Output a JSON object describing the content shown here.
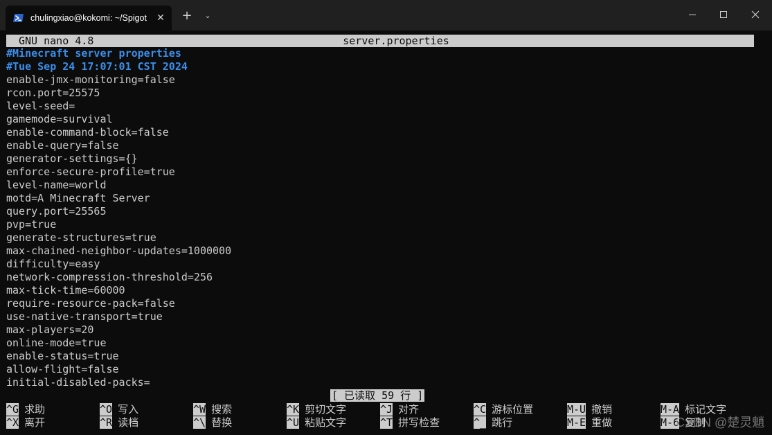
{
  "window": {
    "tab_title": "chulingxiao@kokomi: ~/Spigot",
    "tab_icon": "powershell-terminal-icon",
    "close_glyph": "✕",
    "new_tab_glyph": "+",
    "dropdown_glyph": "⌄"
  },
  "nano": {
    "version": "GNU nano 4.8",
    "filename": "server.properties",
    "lines": [
      "#Minecraft server properties",
      "#Tue Sep 24 17:07:01 CST 2024",
      "enable-jmx-monitoring=false",
      "rcon.port=25575",
      "level-seed=",
      "gamemode=survival",
      "enable-command-block=false",
      "enable-query=false",
      "generator-settings={}",
      "enforce-secure-profile=true",
      "level-name=world",
      "motd=A Minecraft Server",
      "query.port=25565",
      "pvp=true",
      "generate-structures=true",
      "max-chained-neighbor-updates=1000000",
      "difficulty=easy",
      "network-compression-threshold=256",
      "max-tick-time=60000",
      "require-resource-pack=false",
      "use-native-transport=true",
      "max-players=20",
      "online-mode=true",
      "enable-status=true",
      "allow-flight=false",
      "initial-disabled-packs="
    ],
    "status_message": "[ 已读取 59 行 ]",
    "shortcuts_row1": [
      {
        "key": "^G",
        "label": "求助"
      },
      {
        "key": "^O",
        "label": "写入"
      },
      {
        "key": "^W",
        "label": "搜索"
      },
      {
        "key": "^K",
        "label": "剪切文字"
      },
      {
        "key": "^J",
        "label": "对齐"
      },
      {
        "key": "^C",
        "label": "游标位置"
      },
      {
        "key": "M-U",
        "label": "撤销"
      },
      {
        "key": "M-A",
        "label": "标记文字"
      }
    ],
    "shortcuts_row2": [
      {
        "key": "^X",
        "label": "离开"
      },
      {
        "key": "^R",
        "label": "读档"
      },
      {
        "key": "^\\",
        "label": "替换"
      },
      {
        "key": "^U",
        "label": "粘贴文字"
      },
      {
        "key": "^T",
        "label": "拼写检查"
      },
      {
        "key": "^_",
        "label": "跳行"
      },
      {
        "key": "M-E",
        "label": "重做"
      },
      {
        "key": "M-6",
        "label": "复制"
      }
    ]
  },
  "watermark": "CSDN @楚灵魈",
  "colors": {
    "background": "#0c0c0c",
    "titlebar": "#202020",
    "foreground": "#cccccc",
    "comment": "#3b8eea"
  }
}
